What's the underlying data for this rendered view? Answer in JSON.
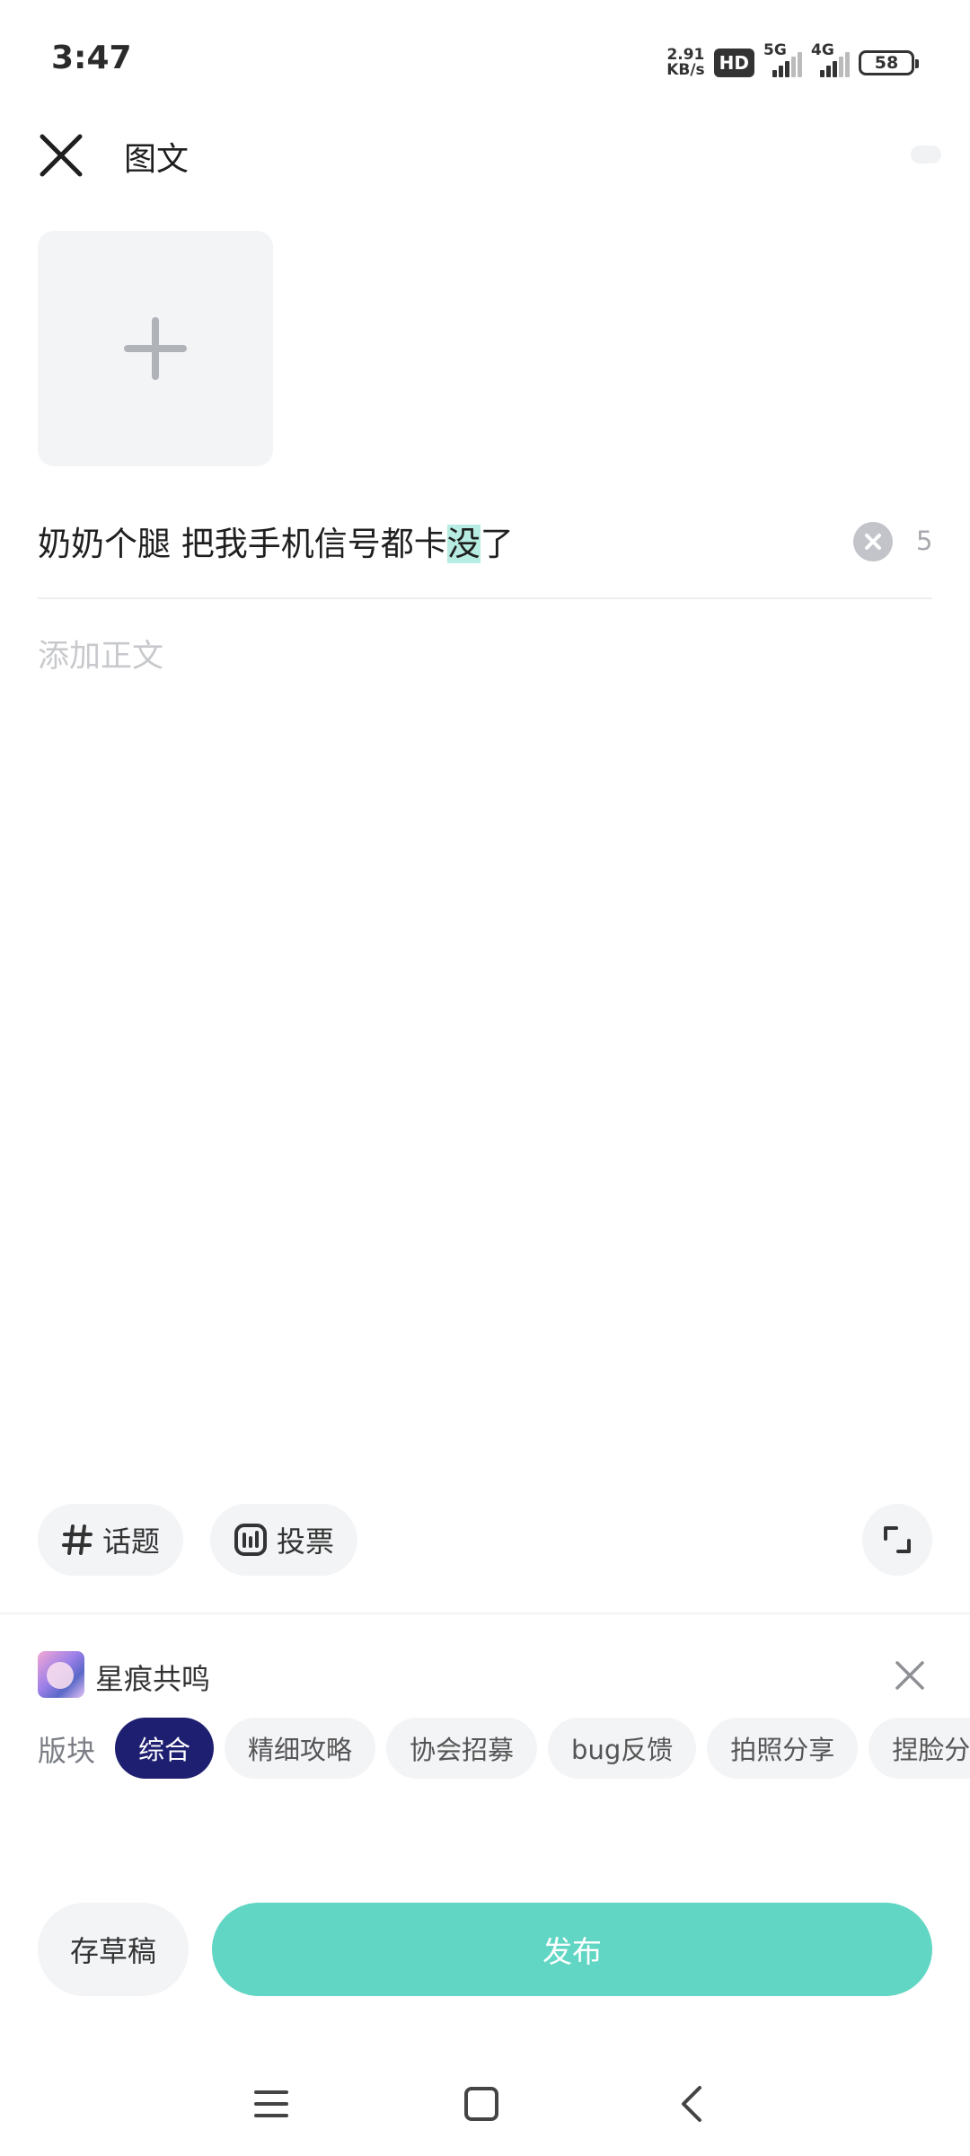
{
  "status_bar": {
    "time": "3:47",
    "net_speed_value": "2.91",
    "net_speed_unit": "KB/s",
    "hd_badge": "HD",
    "signal_1_label": "5G",
    "signal_2_label": "4G",
    "battery": "58"
  },
  "header": {
    "title": "图文",
    "close_icon": "close-icon"
  },
  "editor": {
    "add_image_icon": "plus-icon",
    "title_before": "奶奶个腿 把我手机信号都卡",
    "title_highlight": "没",
    "title_after": "了",
    "title_count": "5",
    "body_placeholder": "添加正文"
  },
  "tools": {
    "topic_label": "话题",
    "poll_label": "投票"
  },
  "game": {
    "name": "星痕共鸣"
  },
  "section": {
    "label": "版块",
    "chips": [
      "综合",
      "精细攻略",
      "协会招募",
      "bug反馈",
      "拍照分享",
      "捏脸分享"
    ],
    "selected": "综合"
  },
  "actions": {
    "draft_label": "存草稿",
    "publish_label": "发布"
  },
  "colors": {
    "accent": "#62d6c4",
    "selected_chip": "#1f1f72",
    "title_highlight": "#b6ece2"
  }
}
